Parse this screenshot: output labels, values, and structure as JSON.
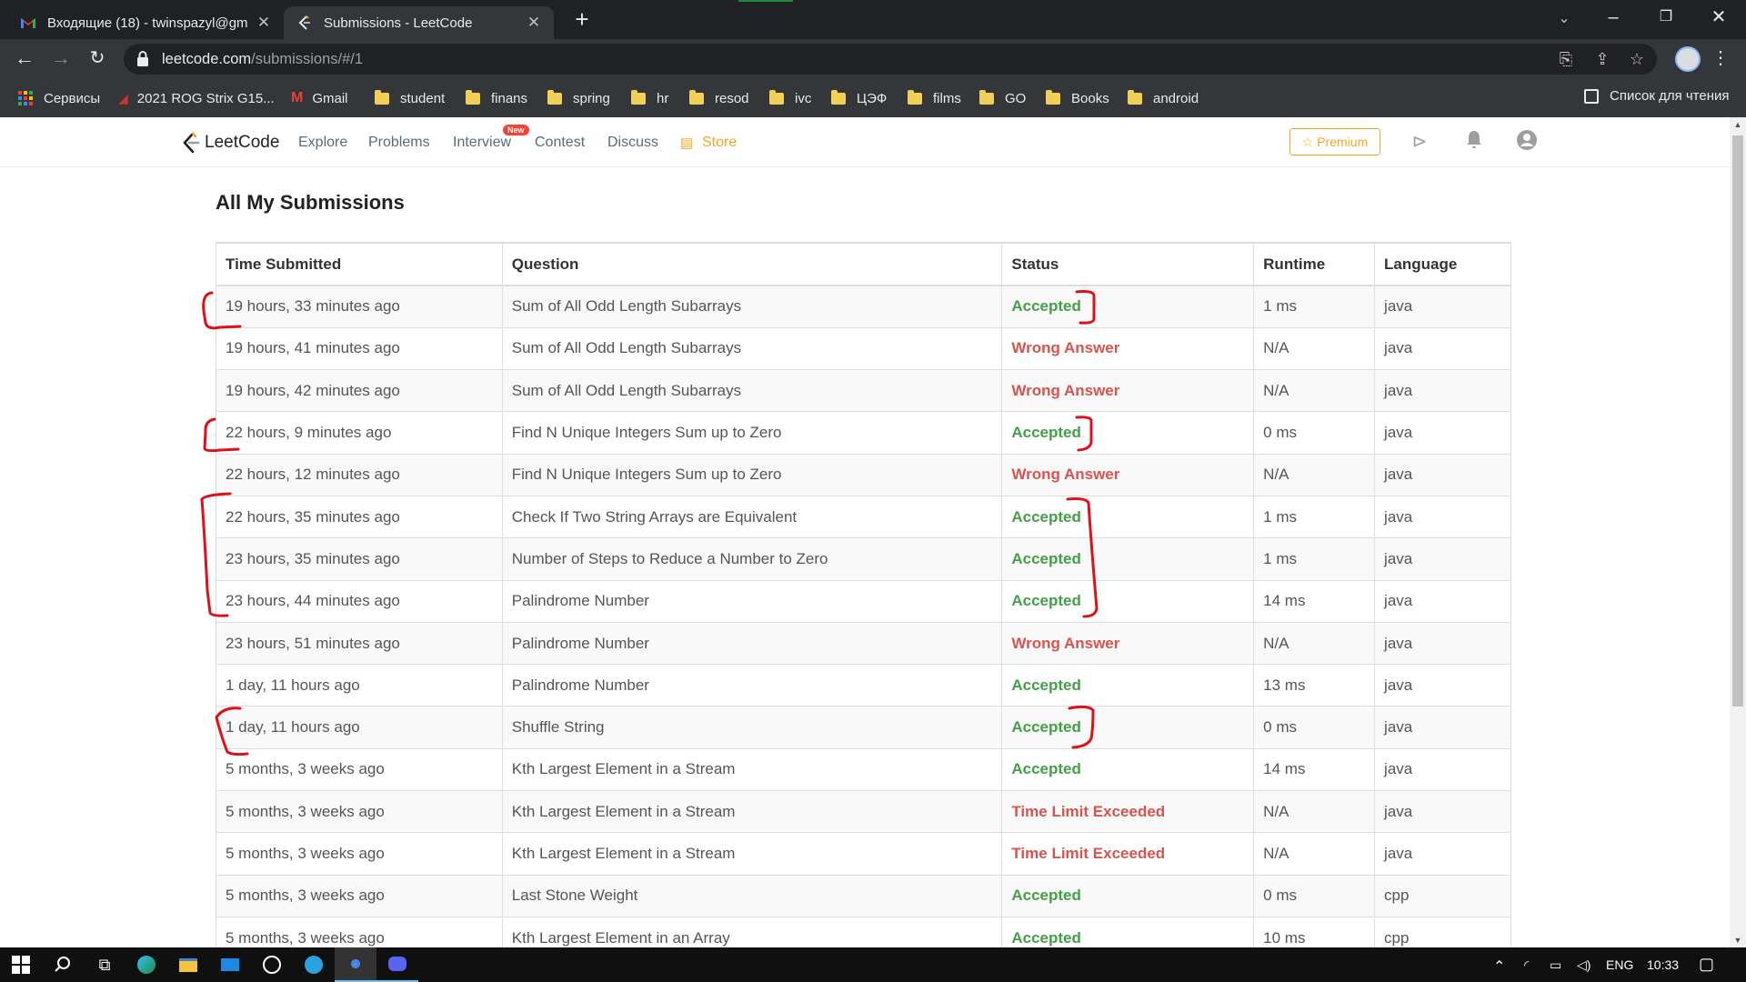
{
  "browser": {
    "tabs": [
      {
        "title": "Входящие (18) - twinspazyl@gm",
        "icon": "gmail-icon",
        "active": false
      },
      {
        "title": "Submissions - LeetCode",
        "icon": "leetcode-icon",
        "active": true
      }
    ],
    "url_host": "leetcode.com",
    "url_path": "/submissions/#/1",
    "bookmarks": [
      {
        "label": "Сервисы",
        "icon": "apps-icon"
      },
      {
        "label": "2021 ROG Strix G15...",
        "icon": "rog-icon"
      },
      {
        "label": "Gmail",
        "icon": "gmail-icon"
      },
      {
        "label": "student",
        "icon": "folder-icon"
      },
      {
        "label": "finans",
        "icon": "folder-icon"
      },
      {
        "label": "spring",
        "icon": "folder-icon"
      },
      {
        "label": "hr",
        "icon": "folder-icon"
      },
      {
        "label": "resod",
        "icon": "folder-icon"
      },
      {
        "label": "ivc",
        "icon": "folder-icon"
      },
      {
        "label": "ЦЭФ",
        "icon": "folder-icon"
      },
      {
        "label": "films",
        "icon": "folder-icon"
      },
      {
        "label": "GO",
        "icon": "folder-icon"
      },
      {
        "label": "Books",
        "icon": "folder-icon"
      },
      {
        "label": "android",
        "icon": "folder-icon"
      }
    ],
    "reading_list": "Список для чтения"
  },
  "leetcode_nav": {
    "brand": "LeetCode",
    "links": [
      "Explore",
      "Problems",
      "Interview",
      "Contest",
      "Discuss"
    ],
    "store": "Store",
    "new_badge": "New",
    "premium": "Premium"
  },
  "page": {
    "title": "All My Submissions",
    "columns": [
      "Time Submitted",
      "Question",
      "Status",
      "Runtime",
      "Language"
    ],
    "rows": [
      {
        "time": "19 hours, 33 minutes ago",
        "question": "Sum of All Odd Length Subarrays",
        "status": "Accepted",
        "runtime": "1 ms",
        "language": "java"
      },
      {
        "time": "19 hours, 41 minutes ago",
        "question": "Sum of All Odd Length Subarrays",
        "status": "Wrong Answer",
        "runtime": "N/A",
        "language": "java"
      },
      {
        "time": "19 hours, 42 minutes ago",
        "question": "Sum of All Odd Length Subarrays",
        "status": "Wrong Answer",
        "runtime": "N/A",
        "language": "java"
      },
      {
        "time": "22 hours, 9 minutes ago",
        "question": "Find N Unique Integers Sum up to Zero",
        "status": "Accepted",
        "runtime": "0 ms",
        "language": "java"
      },
      {
        "time": "22 hours, 12 minutes ago",
        "question": "Find N Unique Integers Sum up to Zero",
        "status": "Wrong Answer",
        "runtime": "N/A",
        "language": "java"
      },
      {
        "time": "22 hours, 35 minutes ago",
        "question": "Check If Two String Arrays are Equivalent",
        "status": "Accepted",
        "runtime": "1 ms",
        "language": "java"
      },
      {
        "time": "23 hours, 35 minutes ago",
        "question": "Number of Steps to Reduce a Number to Zero",
        "status": "Accepted",
        "runtime": "1 ms",
        "language": "java"
      },
      {
        "time": "23 hours, 44 minutes ago",
        "question": "Palindrome Number",
        "status": "Accepted",
        "runtime": "14 ms",
        "language": "java"
      },
      {
        "time": "23 hours, 51 minutes ago",
        "question": "Palindrome Number",
        "status": "Wrong Answer",
        "runtime": "N/A",
        "language": "java"
      },
      {
        "time": "1 day, 11 hours ago",
        "question": "Palindrome Number",
        "status": "Accepted",
        "runtime": "13 ms",
        "language": "java"
      },
      {
        "time": "1 day, 11 hours ago",
        "question": "Shuffle String",
        "status": "Accepted",
        "runtime": "0 ms",
        "language": "java"
      },
      {
        "time": "5 months, 3 weeks ago",
        "question": "Kth Largest Element in a Stream",
        "status": "Accepted",
        "runtime": "14 ms",
        "language": "java"
      },
      {
        "time": "5 months, 3 weeks ago",
        "question": "Kth Largest Element in a Stream",
        "status": "Time Limit Exceeded",
        "runtime": "N/A",
        "language": "java"
      },
      {
        "time": "5 months, 3 weeks ago",
        "question": "Kth Largest Element in a Stream",
        "status": "Time Limit Exceeded",
        "runtime": "N/A",
        "language": "java"
      },
      {
        "time": "5 months, 3 weeks ago",
        "question": "Last Stone Weight",
        "status": "Accepted",
        "runtime": "0 ms",
        "language": "cpp"
      },
      {
        "time": "5 months, 3 weeks ago",
        "question": "Kth Largest Element in an Array",
        "status": "Accepted",
        "runtime": "10 ms",
        "language": "cpp"
      }
    ]
  },
  "taskbar": {
    "language": "ENG",
    "clock": "10:33"
  },
  "colors": {
    "accepted": "#43a047",
    "error": "#d9534f",
    "store": "#f5a623",
    "annotation": "#e0101a"
  }
}
